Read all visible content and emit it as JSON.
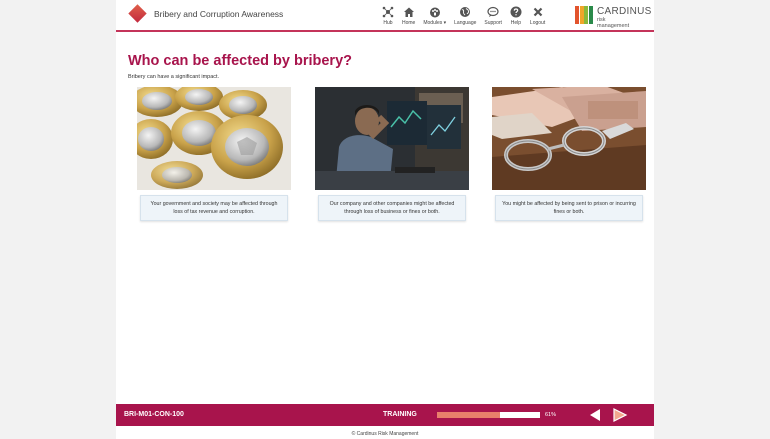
{
  "header": {
    "course_title": "Bribery and Corruption Awareness",
    "nav": [
      {
        "label": "Hub",
        "icon": "hub-icon"
      },
      {
        "label": "Home",
        "icon": "home-icon"
      },
      {
        "label": "Modules ▾",
        "icon": "modules-icon"
      },
      {
        "label": "Language",
        "icon": "globe-icon"
      },
      {
        "label": "Support",
        "icon": "chat-icon"
      },
      {
        "label": "Help",
        "icon": "help-icon"
      },
      {
        "label": "Logout",
        "icon": "close-icon"
      }
    ],
    "brand_name": "CARDINUS",
    "brand_sub": "risk management",
    "brand_colors": [
      "#e2542d",
      "#f0a52a",
      "#8ab83a",
      "#2a8a4a"
    ]
  },
  "content": {
    "title": "Who can be affected by bribery?",
    "subtitle": "Bribery can have a significant impact.",
    "cards": [
      {
        "image": "coins-image",
        "caption": "Your government and society may be affected through loss of tax revenue and corruption."
      },
      {
        "image": "stressed-man-image",
        "caption": "Our company and other companies might be affected through loss of business or fines or both."
      },
      {
        "image": "handcuffs-money-image",
        "caption": "You might be affected by being sent to prison or incurring fines or both."
      }
    ]
  },
  "footer": {
    "page_code": "BRI-M01-CON-100",
    "section": "TRAINING",
    "progress": 0.61,
    "progress_label": "61%",
    "copyright": "© Cardinus Risk Management"
  },
  "colors": {
    "accent": "#a8144c",
    "progress_fill": "#e9806b",
    "caption_bg": "#eef4f9"
  }
}
